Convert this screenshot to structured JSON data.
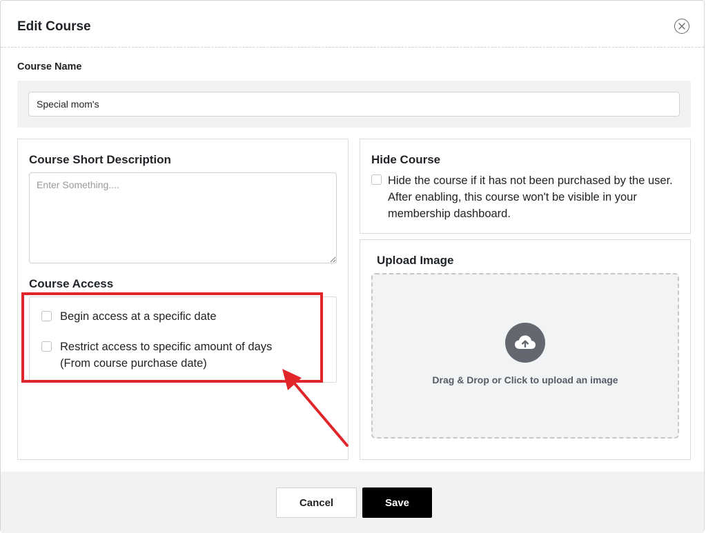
{
  "modal": {
    "title": "Edit Course",
    "close_icon": "close-circle-icon"
  },
  "course_name": {
    "label": "Course Name",
    "value": "Special mom's"
  },
  "description": {
    "title": "Course Short Description",
    "placeholder": "Enter Something...."
  },
  "access": {
    "title": "Course Access",
    "options": [
      {
        "line1": "Begin access at a specific date",
        "line2": "",
        "checked": false
      },
      {
        "line1": "Restrict access to specific amount of days",
        "line2": "(From course purchase date)",
        "checked": false
      }
    ]
  },
  "hide_course": {
    "title": "Hide Course",
    "line1": "Hide the course if it has not been purchased by the user.",
    "line2": "After enabling, this course won't be visible in your",
    "line3": "membership dashboard.",
    "checked": false
  },
  "upload": {
    "title": "Upload Image",
    "icon": "cloud-upload-icon",
    "text": "Drag & Drop or Click to upload an image"
  },
  "footer": {
    "cancel_label": "Cancel",
    "save_label": "Save"
  },
  "colors": {
    "annotation": "#e0262b",
    "save_button": "#000000",
    "upload_icon_bg": "#636770"
  }
}
